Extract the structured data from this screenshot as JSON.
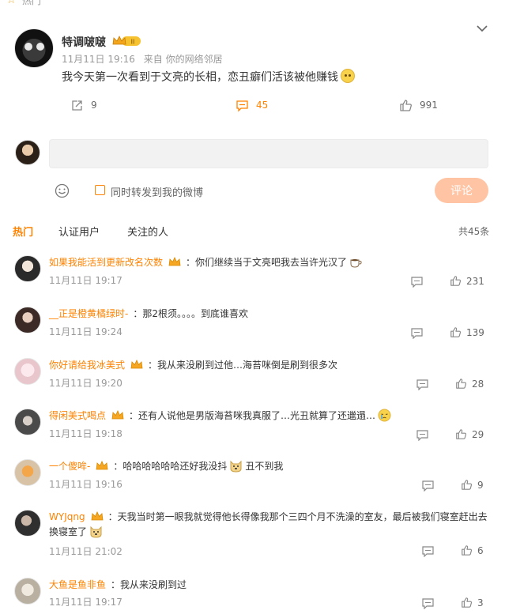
{
  "top": {
    "label": "热门"
  },
  "post": {
    "author": "特调啵啵",
    "vip_level": "II",
    "date": "11月11日 19:16",
    "source": "来自 你的网络邻居",
    "text": "我今天第一次看到于文亮的长相，恋丑癖们活该被他赚钱",
    "forward_count": "9",
    "comment_count": "45",
    "like_count": "991"
  },
  "composer": {
    "input_placeholder": "",
    "repost_label": "同时转发到我的微博",
    "submit_label": "评论"
  },
  "tabs": [
    {
      "label": "热门",
      "active": true
    },
    {
      "label": "认证用户",
      "active": false
    },
    {
      "label": "关注的人",
      "active": false
    }
  ],
  "total_comments": "共45条",
  "comments": [
    {
      "name": "如果我能活到更新改名次数",
      "text": "：你们继续当于文亮吧我去当许光汉了",
      "time": "11月11日 19:17",
      "likes": "231",
      "avatar_color": "#2a2a2a"
    },
    {
      "name": "__正是橙黄橘绿时-",
      "text": "：那2根须。。。。到底谁喜欢",
      "time": "11月11日 19:24",
      "likes": "139",
      "avatar_color": "#3b2a25"
    },
    {
      "name": "你好请给我冰美式",
      "text": "：我从来没刷到过他…海苔咪倒是刷到很多次",
      "time": "11月11日 19:20",
      "likes": "28",
      "avatar_color": "#e8c6cc"
    },
    {
      "name": "得闲美式喝点",
      "text": "：还有人说他是男版海苔咪我真服了…光丑就算了还邋遢…",
      "time": "11月11日 19:18",
      "likes": "29",
      "avatar_color": "#4a4a4a"
    },
    {
      "name": "一个傻哞-",
      "text": "：哈哈哈哈哈哈还好我没抖",
      "text2": "丑不到我",
      "time": "11月11日 19:16",
      "likes": "9",
      "avatar_color": "#d9c3a6"
    },
    {
      "name": "WYJqng",
      "text": "：天我当时第一眼我就觉得他长得像我那个三四个月不洗澡的室友，最后被我们寝室赶出去",
      "text_line2": "换寝室了",
      "time": "11月11日 21:02",
      "likes": "6",
      "avatar_color": "#2f2f2f"
    },
    {
      "name": "大鱼是鱼非鱼",
      "text": "：我从来没刷到过",
      "time": "11月11日 19:17",
      "likes": "3",
      "avatar_color": "#b9b0a2"
    }
  ],
  "colors": {
    "accent": "#ff8200",
    "muted": "#999999",
    "submit_bg": "#ffc4a4"
  },
  "icons": [
    "chevron-down-icon",
    "forward-icon",
    "comment-icon",
    "like-icon",
    "emoji-icon",
    "crown-icon",
    "reply-icon"
  ]
}
